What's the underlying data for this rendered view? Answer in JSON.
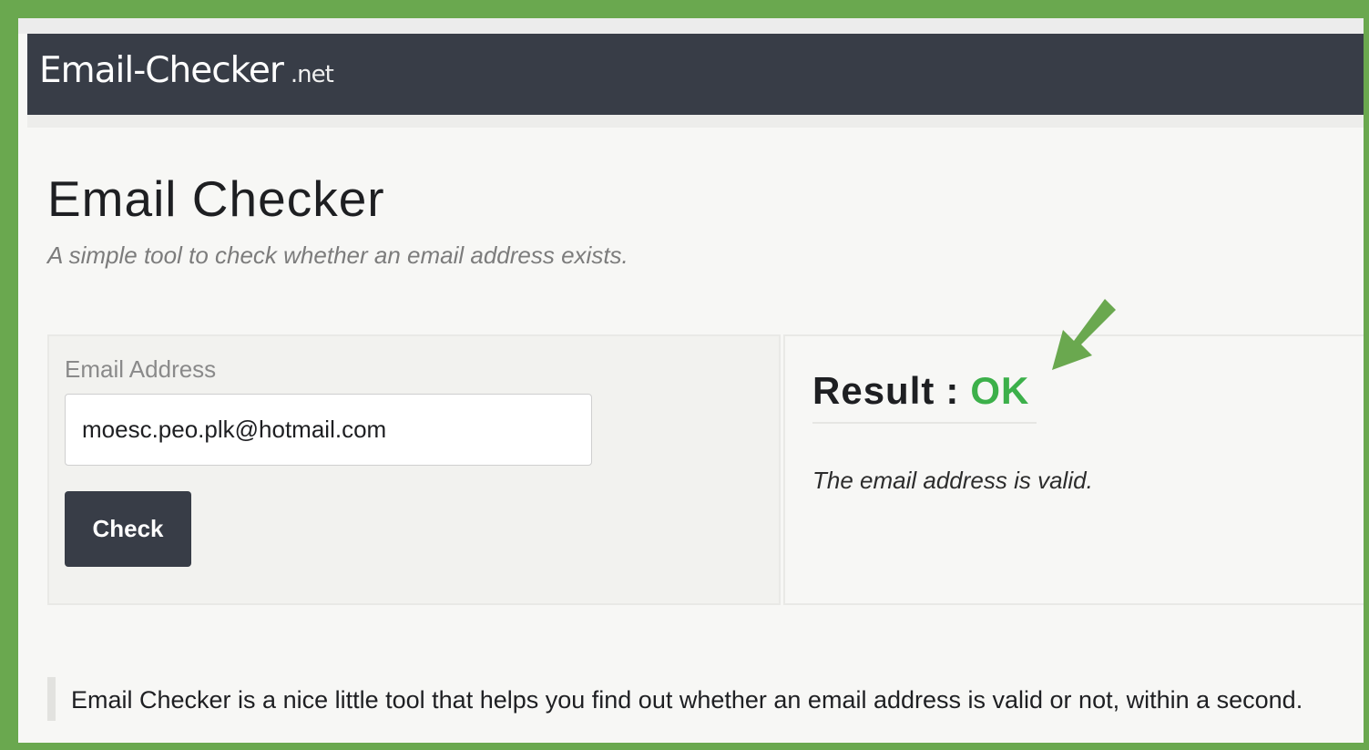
{
  "header": {
    "brand_name": "Email-Checker",
    "brand_tld": ".net"
  },
  "main": {
    "title": "Email Checker",
    "subtitle": "A simple tool to check whether an email address exists."
  },
  "form": {
    "email_label": "Email Address",
    "email_value": "moesc.peo.plk@hotmail.com",
    "check_label": "Check"
  },
  "result": {
    "label": "Result",
    "separator": ":",
    "value": "OK",
    "message": "The email address is valid."
  },
  "description": "Email Checker is a nice little tool that helps you find out whether an email address is valid or not, within a second.",
  "colors": {
    "frame_border": "#6aa84f",
    "navbar": "#383d47",
    "ok_green": "#3cb04a",
    "arrow_green": "#6aa84f"
  },
  "icons": {
    "annotation_arrow": "down-left-arrow-icon"
  }
}
